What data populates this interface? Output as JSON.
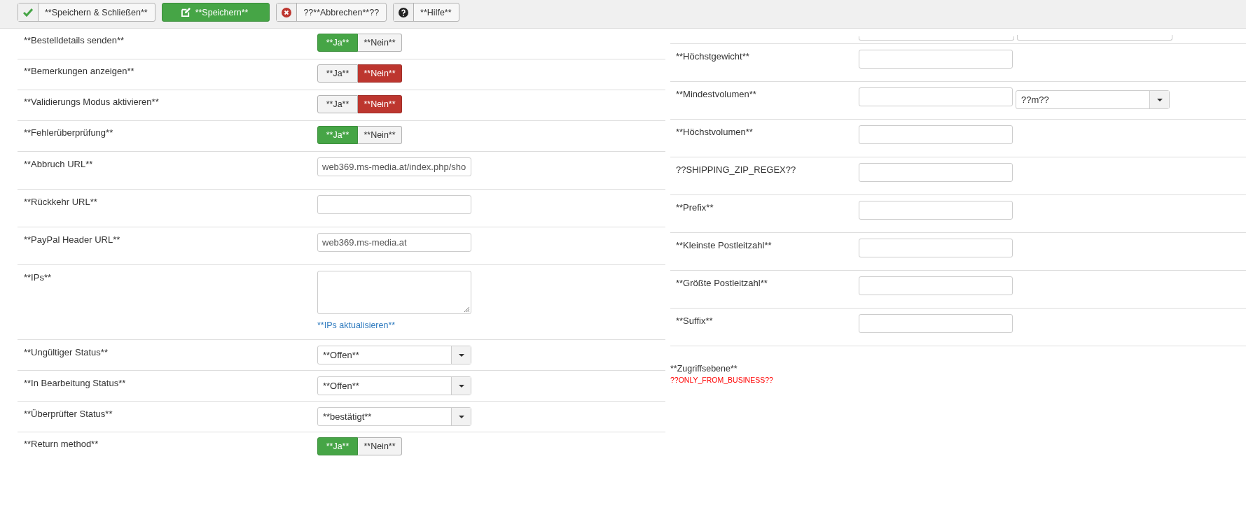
{
  "toolbar": {
    "buttons": [
      {
        "kind": "save-close",
        "label": "**Speichern & Schließen**"
      },
      {
        "kind": "save",
        "label": "**Speichern**"
      },
      {
        "kind": "cancel",
        "label": "??**Abbrechen**??"
      },
      {
        "kind": "help",
        "label": "**Hilfe**"
      }
    ]
  },
  "left": {
    "rows": [
      {
        "kind": "toggle",
        "label": "**Bestelldetails senden**",
        "options": [
          {
            "label": "**Ja**",
            "selected": true
          },
          {
            "label": "**Nein**",
            "selected": false
          }
        ]
      },
      {
        "kind": "toggle",
        "label": "**Bemerkungen anzeigen**",
        "options": [
          {
            "label": "**Ja**",
            "selected": false
          },
          {
            "label": "**Nein**",
            "selected": true
          }
        ]
      },
      {
        "kind": "toggle",
        "label": "**Validierungs Modus aktivieren**",
        "options": [
          {
            "label": "**Ja**",
            "selected": false
          },
          {
            "label": "**Nein**",
            "selected": true
          }
        ]
      },
      {
        "kind": "toggle",
        "label": "**Fehlerüberprüfung**",
        "options": [
          {
            "label": "**Ja**",
            "selected": true
          },
          {
            "label": "**Nein**",
            "selected": false
          }
        ]
      },
      {
        "kind": "text",
        "label": "**Abbruch URL**",
        "value": "web369.ms-media.at/index.php/sho"
      },
      {
        "kind": "text",
        "label": "**Rückkehr URL**"
      },
      {
        "kind": "text",
        "label": "**PayPal Header URL**",
        "value": "web369.ms-media.at"
      },
      {
        "kind": "textarea",
        "label": "**IPs**",
        "link": "**IPs aktualisieren**"
      },
      {
        "kind": "select",
        "label": "**Ungültiger Status**",
        "value": "**Offen**"
      },
      {
        "kind": "select",
        "label": "**In Bearbeitung Status**",
        "value": "**Offen**"
      },
      {
        "kind": "select",
        "label": "**Überprüfter Status**",
        "value": "**bestätigt**"
      },
      {
        "kind": "toggle",
        "label": "**Return method**",
        "options": [
          {
            "label": "**Ja**",
            "selected": true
          },
          {
            "label": "**Nein**",
            "selected": false
          }
        ]
      }
    ]
  },
  "right": {
    "rows": [
      {
        "kind": "partial"
      },
      {
        "kind": "text",
        "label": "**Höchstgewicht**"
      },
      {
        "kind": "text_select",
        "label": "**Mindestvolumen**",
        "select_value": "??m??"
      },
      {
        "kind": "text",
        "label": "**Höchstvolumen**"
      },
      {
        "kind": "text",
        "label": "??SHIPPING_ZIP_REGEX??"
      },
      {
        "kind": "text",
        "label": "**Prefix**"
      },
      {
        "kind": "text",
        "label": "**Kleinste Postleitzahl**"
      },
      {
        "kind": "text",
        "label": "**Größte Postleitzahl**"
      },
      {
        "kind": "text",
        "label": "**Suffix**"
      }
    ],
    "access": {
      "label": "**Zugriffsebene**",
      "value": "??ONLY_FROM_BUSINESS??"
    }
  }
}
